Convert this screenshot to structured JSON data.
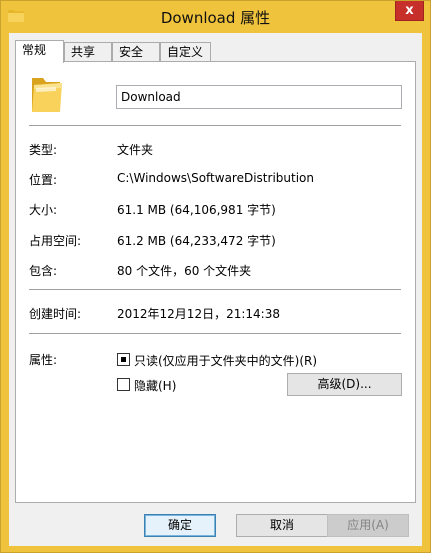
{
  "window": {
    "title": "Download 属性",
    "close_glyph": "x"
  },
  "tabs": [
    {
      "label": "常规",
      "active": true
    },
    {
      "label": "共享",
      "active": false
    },
    {
      "label": "安全",
      "active": false
    },
    {
      "label": "自定义",
      "active": false
    }
  ],
  "general": {
    "folder_name": "Download",
    "type_label": "类型:",
    "type_value": "文件夹",
    "location_label": "位置:",
    "location_value": "C:\\Windows\\SoftwareDistribution",
    "size_label": "大小:",
    "size_value": "61.1 MB (64,106,981 字节)",
    "size_on_disk_label": "占用空间:",
    "size_on_disk_value": "61.2 MB (64,233,472 字节)",
    "contains_label": "包含:",
    "contains_value": "80 个文件，60 个文件夹",
    "created_label": "创建时间:",
    "created_value": "2012年12月12日，21:14:38",
    "attributes_label": "属性:",
    "readonly_label": "只读(仅应用于文件夹中的文件)(R)",
    "readonly_state": "indeterminate",
    "hidden_label": "隐藏(H)",
    "hidden_checked": false,
    "advanced_button": "高级(D)..."
  },
  "footer": {
    "ok_label": "确定",
    "cancel_label": "取消",
    "apply_label": "应用(A)",
    "apply_enabled": false
  },
  "colors": {
    "frame": "#f0c33c",
    "close": "#c7302a",
    "dialog_bg": "#f0f0f0"
  },
  "icons": {
    "title": "folder-icon",
    "folder": "folder-icon"
  }
}
